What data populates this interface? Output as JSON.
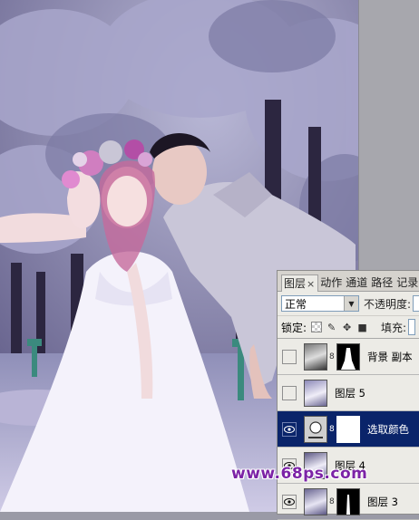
{
  "panel": {
    "tabs": [
      {
        "label": "图层",
        "close": "×",
        "active": true
      },
      {
        "label": "动作"
      },
      {
        "label": "通道"
      },
      {
        "label": "路径"
      },
      {
        "label": "记录"
      }
    ],
    "blend_mode": "正常",
    "opacity_label": "不透明度:",
    "lock_label": "锁定:",
    "fill_label": "填充:",
    "layers": [
      {
        "name": "背景 副本",
        "visible": false,
        "has_mask": true,
        "selected": false
      },
      {
        "name": "图层 5",
        "visible": false,
        "has_mask": false,
        "selected": false
      },
      {
        "name": "选取颜色",
        "visible": true,
        "has_mask": true,
        "selected": true,
        "adjustment": true
      },
      {
        "name": "图层 4",
        "visible": true,
        "has_mask": false,
        "selected": false
      },
      {
        "name": "图层 3",
        "visible": true,
        "has_mask": true,
        "selected": false
      }
    ]
  },
  "watermark": {
    "text": "www.68ps.com"
  },
  "colors": {
    "selected_row": "#0a246a",
    "watermark": "#7c23a6",
    "panel_bg": "#ecebe6"
  }
}
